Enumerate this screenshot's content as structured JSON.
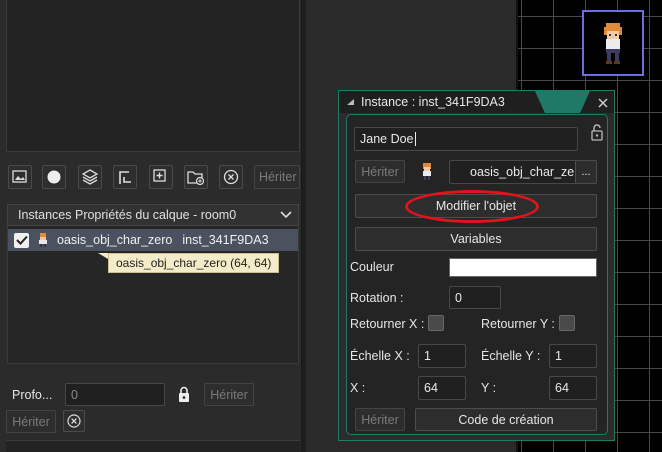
{
  "layer_toolbar": {
    "inherit_label": "Hériter"
  },
  "instances_panel": {
    "header": "Instances Propriétés du calque - room0",
    "row": {
      "object_name": "oasis_obj_char_zero",
      "instance_id": "inst_341F9DA3"
    },
    "tooltip": "oasis_obj_char_zero (64, 64)"
  },
  "depth": {
    "label": "Profo...",
    "value": "0",
    "inherit_label": "Hériter",
    "inherit_label_2": "Hériter"
  },
  "dialog": {
    "title": "Instance : inst_341F9DA3",
    "name_value": "Jane Doe",
    "inherit_label": "Hériter",
    "object_name": "oasis_obj_char_zero",
    "object_menu_label": "...",
    "modify_object_label": "Modifier l'objet",
    "variables_label": "Variables",
    "color_label": "Couleur",
    "color_value": "#ffffff",
    "rotation_label": "Rotation :",
    "rotation_value": "0",
    "flip_x_label": "Retourner X :",
    "flip_y_label": "Retourner Y :",
    "scale_x_label": "Échelle X :",
    "scale_x_value": "1",
    "scale_y_label": "Échelle Y :",
    "scale_y_value": "1",
    "x_label": "X :",
    "x_value": "64",
    "y_label": "Y :",
    "y_value": "64",
    "inherit_label_2": "Hériter",
    "creation_code_label": "Code de création"
  },
  "colors": {
    "accent": "#1f7a66",
    "highlight_circle": "#e0141c",
    "selection_row": "#4a5260",
    "tooltip_bg": "#f4ecc8"
  }
}
